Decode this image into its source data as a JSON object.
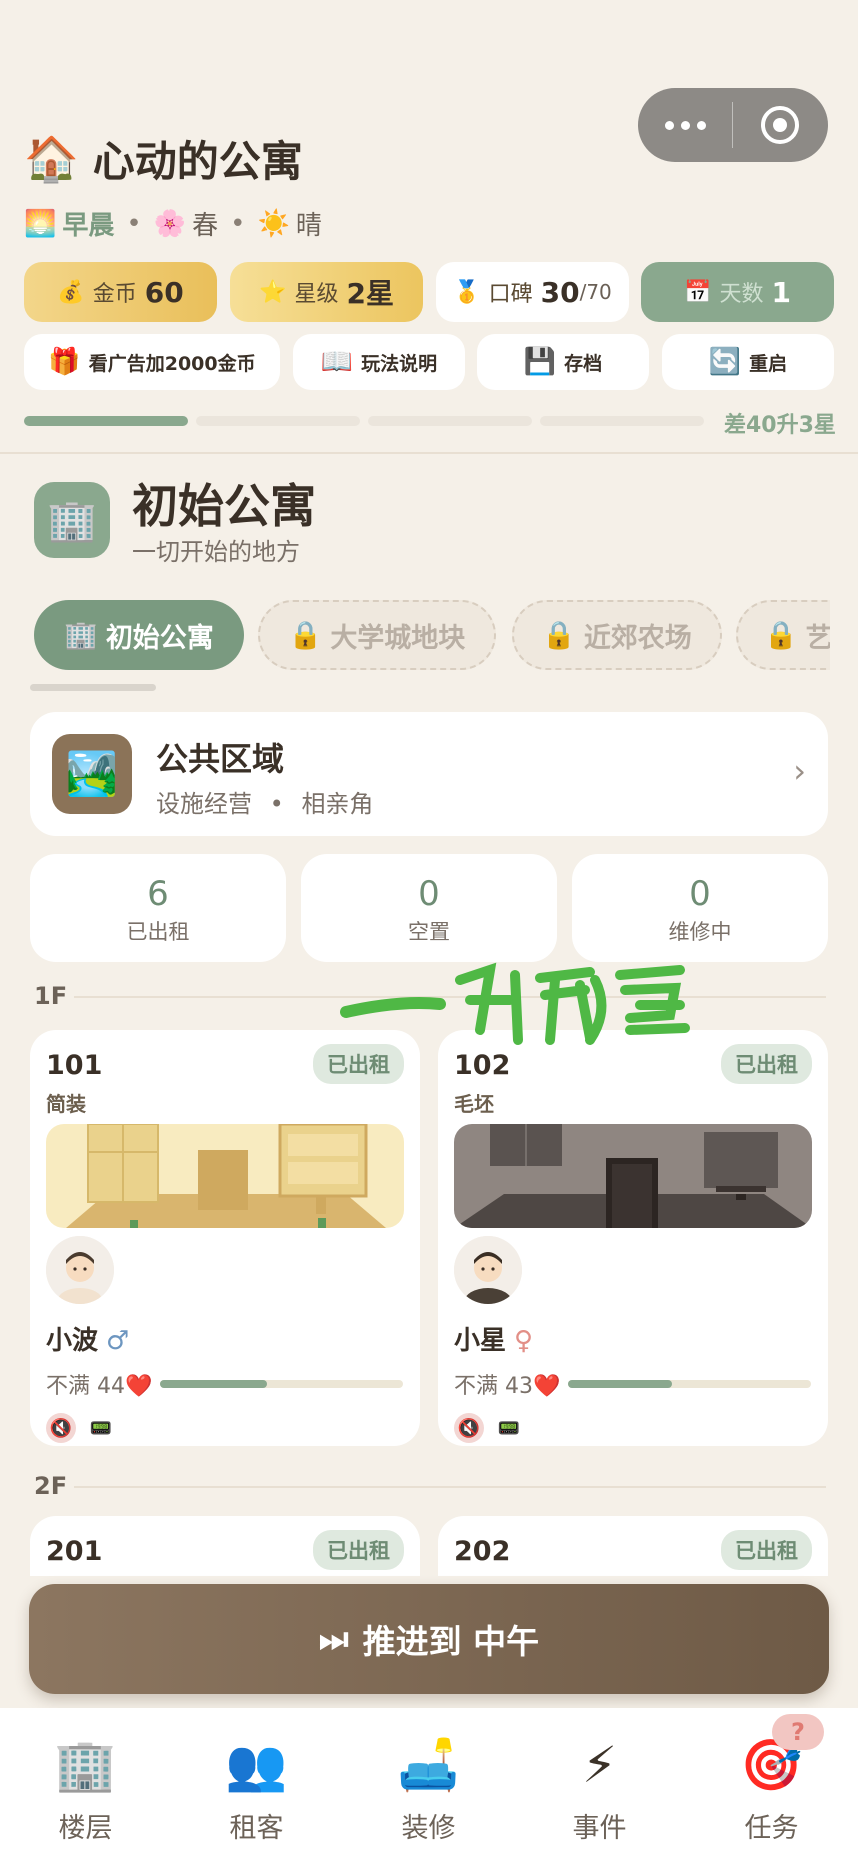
{
  "header": {
    "capsule": {
      "more_icon": "more-dots-icon",
      "close_icon": "target-close-icon"
    },
    "title": "心动的公寓",
    "title_icon": "house-icon",
    "time_of_day": "早晨",
    "season": "春",
    "weather": "晴"
  },
  "stats": {
    "gold_label": "金币",
    "gold_value": "60",
    "star_label": "星级",
    "star_value": "2星",
    "rep_label": "口碑",
    "rep_value": "30",
    "rep_max": "/70",
    "day_label": "天数",
    "day_value": "1"
  },
  "actions": [
    {
      "label": "看广告加2000金币",
      "icon": "gift-icon"
    },
    {
      "label": "玩法说明",
      "icon": "book-icon"
    },
    {
      "label": "存档",
      "icon": "save-icon"
    },
    {
      "label": "重启",
      "icon": "restart-icon"
    }
  ],
  "progress": {
    "label": "差40升3星",
    "filled_segments": 1,
    "total_segments": 4
  },
  "building": {
    "name": "初始公寓",
    "subtitle": "一切开始的地方"
  },
  "building_tabs": [
    {
      "label": "初始公寓",
      "locked": false
    },
    {
      "label": "大学城地块",
      "locked": true
    },
    {
      "label": "近郊农场",
      "locked": true
    },
    {
      "label": "艺",
      "locked": true
    }
  ],
  "public_area": {
    "name": "公共区域",
    "desc1": "设施经营",
    "desc2": "相亲角"
  },
  "counts": [
    {
      "value": "6",
      "label": "已出租"
    },
    {
      "value": "0",
      "label": "空置"
    },
    {
      "value": "0",
      "label": "维修中"
    }
  ],
  "floors": [
    {
      "label": "1F"
    },
    {
      "label": "2F"
    }
  ],
  "rooms": [
    {
      "number": "101",
      "status": "已出租",
      "style": "简装",
      "tenant": "小波",
      "gender": "♂",
      "mood_label": "不满",
      "mood_value": "44",
      "mood_fraction": 0.44
    },
    {
      "number": "102",
      "status": "已出租",
      "style": "毛坯",
      "tenant": "小星",
      "gender": "♀",
      "mood_label": "不满",
      "mood_value": "43",
      "mood_fraction": 0.43
    },
    {
      "number": "201",
      "status": "已出租"
    },
    {
      "number": "202",
      "status": "已出租"
    }
  ],
  "advance_button": {
    "label": "推进到 中午"
  },
  "watermark": "一剑飘雪",
  "tabbar": [
    {
      "label": "楼层",
      "icon": "building-icon"
    },
    {
      "label": "租客",
      "icon": "tenants-icon"
    },
    {
      "label": "装修",
      "icon": "sofa-icon"
    },
    {
      "label": "事件",
      "icon": "lightning-icon"
    },
    {
      "label": "任务",
      "icon": "target-icon"
    }
  ],
  "task_badge": "?"
}
